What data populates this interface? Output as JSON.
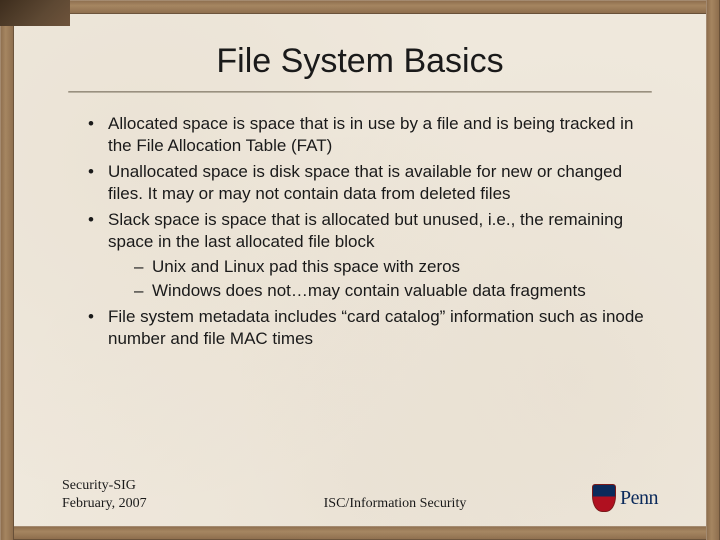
{
  "title": "File System Basics",
  "bullets": [
    {
      "text": "Allocated space is space that is in use by a file and is being tracked in the File Allocation Table (FAT)"
    },
    {
      "text": "Unallocated space is disk space that is available for new or changed files. It may or may not contain data from deleted files"
    },
    {
      "text": "Slack space is space that is allocated but unused, i.e., the remaining space in the last allocated file block",
      "sub": [
        "Unix and Linux pad this space with zeros",
        "Windows does not…may contain valuable data fragments"
      ]
    },
    {
      "text": "File system metadata includes “card catalog” information such as inode number and file MAC times"
    }
  ],
  "footer": {
    "left_line1": "Security-SIG",
    "left_line2": "February, 2007",
    "center": "ISC/Information Security",
    "logo_text": "Penn"
  }
}
